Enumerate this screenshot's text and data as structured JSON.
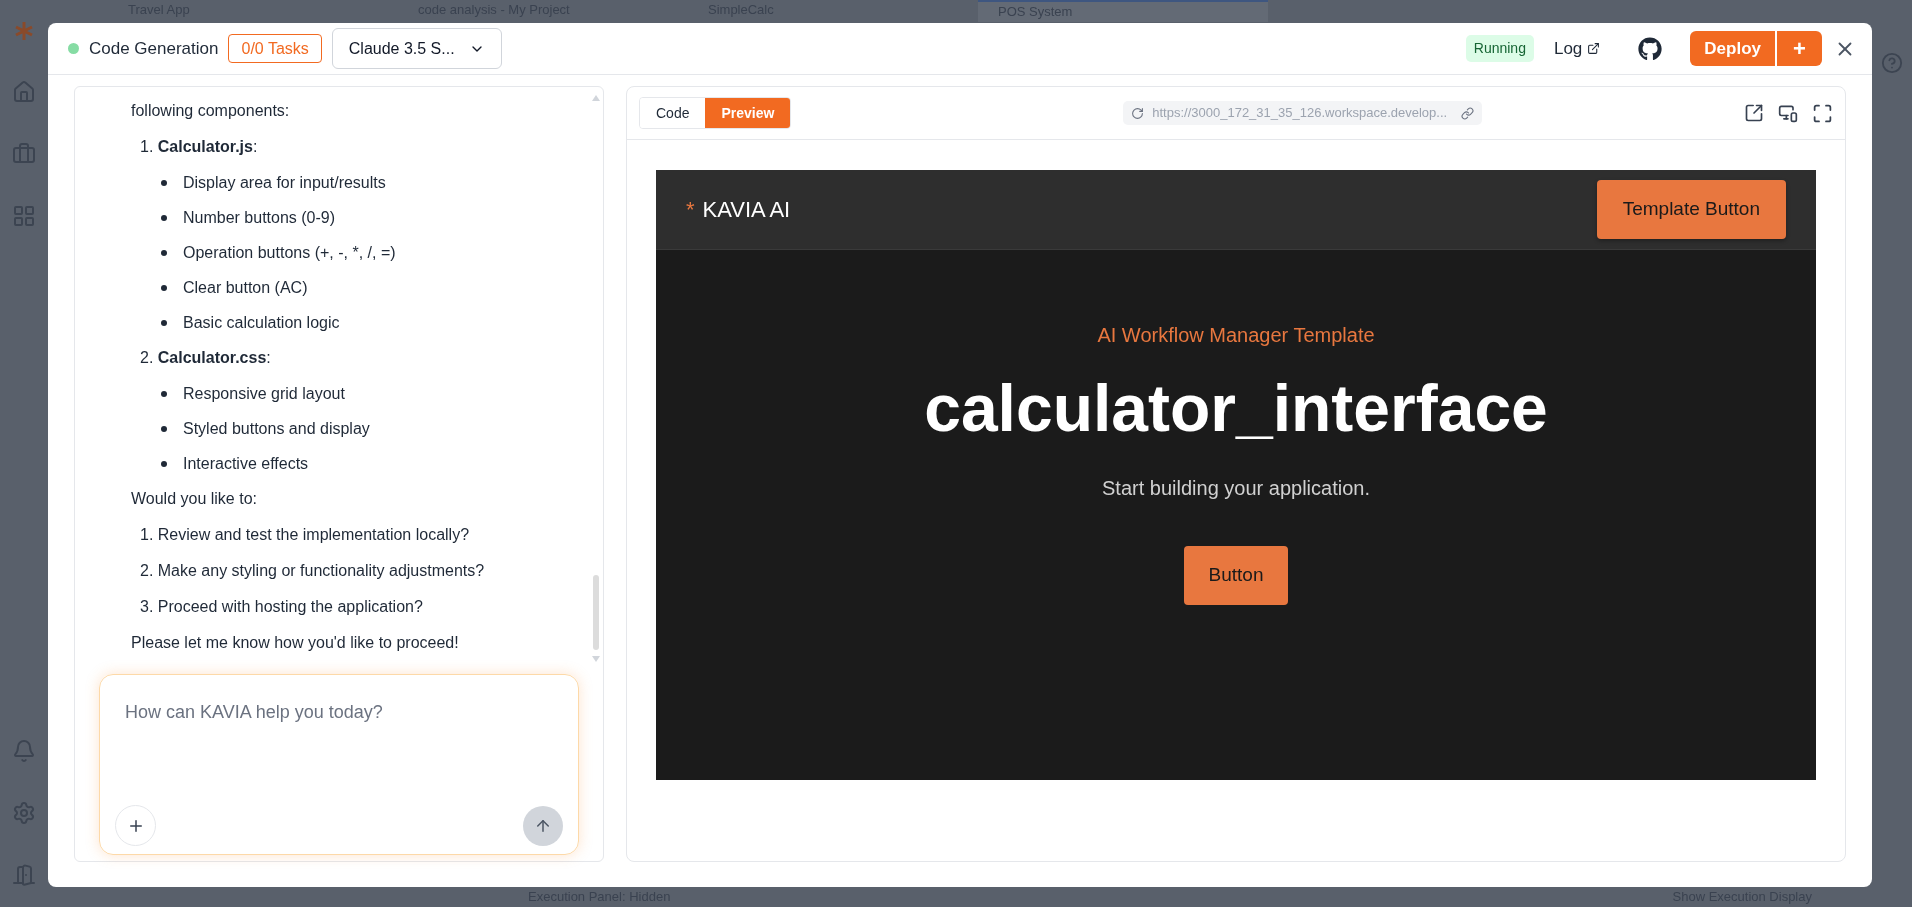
{
  "background": {
    "tabs": [
      {
        "label": "Travel App",
        "selected": false
      },
      {
        "label": "code analysis - My Project",
        "selected": false
      },
      {
        "label": "SimpleCalc",
        "selected": false
      },
      {
        "label": "POS System",
        "selected": true
      }
    ],
    "footer": {
      "panel_status": "Execution Panel: Hidden",
      "toggle": "Show Execution Display"
    }
  },
  "dialog": {
    "title": "Code Generation",
    "tasks": "0/0 Tasks",
    "model": "Claude 3.5 S...",
    "status": "Running",
    "log": "Log",
    "deploy": "Deploy",
    "deploy_more": "+"
  },
  "chat": {
    "blocks": [
      {
        "kind": "paragraph",
        "text": "following components:"
      },
      {
        "kind": "numbered",
        "text": "1. **Calculator.js**:",
        "children": [
          {
            "text": "Display area for input/results"
          },
          {
            "text": "Number buttons (0-9)"
          },
          {
            "text": "Operation buttons (+, -, *, /, =)"
          },
          {
            "text": "Clear button (AC)"
          },
          {
            "text": "Basic calculation logic"
          }
        ]
      },
      {
        "kind": "numbered",
        "text": "2. **Calculator.css**:",
        "children": [
          {
            "text": "Responsive grid layout"
          },
          {
            "text": "Styled buttons and display"
          },
          {
            "text": "Interactive effects"
          }
        ]
      },
      {
        "kind": "paragraph",
        "text": "Would you like to:"
      },
      {
        "kind": "numbered",
        "text": "1. Review and test the implementation locally?"
      },
      {
        "kind": "numbered",
        "text": "2. Make any styling or functionality adjustments?"
      },
      {
        "kind": "numbered",
        "text": "3. Proceed with hosting the application?"
      },
      {
        "kind": "paragraph",
        "text": "Please let me know how you'd like to proceed!"
      }
    ],
    "input": {
      "placeholder": "How can KAVIA help you today?"
    }
  },
  "preview": {
    "tabs": [
      {
        "label": "Code",
        "selected": false
      },
      {
        "label": "Preview",
        "selected": true
      }
    ],
    "url": "https://3000_172_31_35_126.workspace.develop...",
    "app": {
      "brand_mark": "*",
      "brand": "KAVIA AI",
      "header_button": "Template Button",
      "subtitle": "AI Workflow Manager Template",
      "title": "calculator_interface",
      "tagline": "Start building your application.",
      "button": "Button"
    }
  }
}
